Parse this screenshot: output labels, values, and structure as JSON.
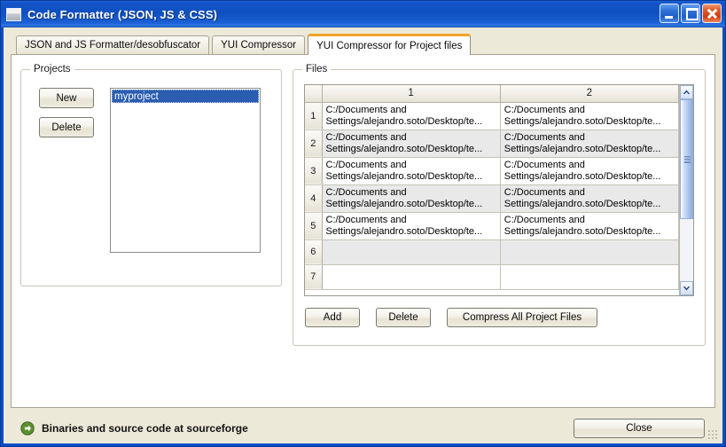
{
  "window": {
    "title": "Code Formatter (JSON, JS & CSS)",
    "icon": "app-window-icon",
    "buttons": {
      "minimize": "minimize-icon",
      "maximize": "maximize-icon",
      "close": "close-icon"
    }
  },
  "tabs": [
    {
      "label": "JSON and JS Formatter/desobfuscator",
      "active": false
    },
    {
      "label": "YUI Compressor",
      "active": false
    },
    {
      "label": "YUI Compressor for Project files",
      "active": true
    }
  ],
  "projects": {
    "group_title": "Projects",
    "new_label": "New",
    "delete_label": "Delete",
    "items": [
      {
        "label": "myproject",
        "selected": true
      }
    ]
  },
  "files": {
    "group_title": "Files",
    "columns": [
      "1",
      "2"
    ],
    "rows": [
      {
        "num": "1",
        "c1": "C:/Documents and\nSettings/alejandro.soto/Desktop/te...",
        "c2": "C:/Documents and\nSettings/alejandro.soto/Desktop/te..."
      },
      {
        "num": "2",
        "c1": "C:/Documents and\nSettings/alejandro.soto/Desktop/te...",
        "c2": "C:/Documents and\nSettings/alejandro.soto/Desktop/te..."
      },
      {
        "num": "3",
        "c1": "C:/Documents and\nSettings/alejandro.soto/Desktop/te...",
        "c2": "C:/Documents and\nSettings/alejandro.soto/Desktop/te..."
      },
      {
        "num": "4",
        "c1": "C:/Documents and\nSettings/alejandro.soto/Desktop/te...",
        "c2": "C:/Documents and\nSettings/alejandro.soto/Desktop/te..."
      },
      {
        "num": "5",
        "c1": "C:/Documents and\nSettings/alejandro.soto/Desktop/te...",
        "c2": "C:/Documents and\nSettings/alejandro.soto/Desktop/te..."
      },
      {
        "num": "6",
        "c1": "",
        "c2": ""
      },
      {
        "num": "7",
        "c1": "",
        "c2": ""
      }
    ],
    "buttons": {
      "add": "Add",
      "delete": "Delete",
      "compress": "Compress All Project Files"
    },
    "scrollbar": {
      "up_icon": "chevron-up-icon",
      "down_icon": "chevron-down-icon"
    }
  },
  "status": {
    "icon": "green-arrow-icon",
    "text": "Binaries and source code at sourceforge",
    "close_label": "Close"
  },
  "colors": {
    "title_bar": "#0f4fc0",
    "active_tab_accent": "#f0a32a",
    "selection": "#2a5db0",
    "client_bg": "#ece9d8",
    "status_icon": "#4f8a2a"
  }
}
